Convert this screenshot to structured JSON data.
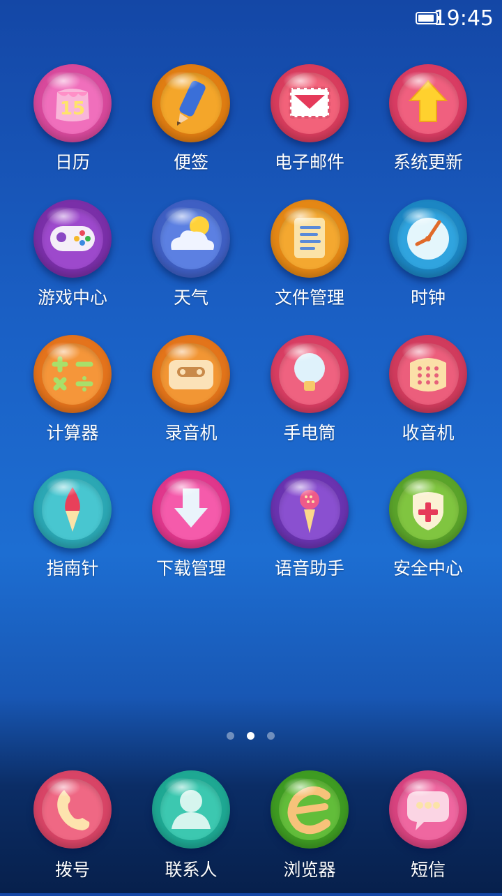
{
  "status": {
    "time": "19:45",
    "battery_percent": 90
  },
  "apps": [
    {
      "id": "calendar",
      "label": "日历",
      "color": "#d8499c",
      "inner": "#f06fbc",
      "icon": "calendar-icon",
      "text": "15"
    },
    {
      "id": "notes",
      "label": "便签",
      "color": "#e07d12",
      "inner": "#f4a62a",
      "icon": "pencil-icon"
    },
    {
      "id": "email",
      "label": "电子邮件",
      "color": "#d83c5d",
      "inner": "#f2627a",
      "icon": "envelope-icon"
    },
    {
      "id": "update",
      "label": "系统更新",
      "color": "#d93c63",
      "inner": "#f0607f",
      "icon": "up-arrow-icon"
    },
    {
      "id": "games",
      "label": "游戏中心",
      "color": "#7a2fa8",
      "inner": "#9d49cc",
      "icon": "gamepad-icon"
    },
    {
      "id": "weather",
      "label": "天气",
      "color": "#3f5fc3",
      "inner": "#5c80e2",
      "icon": "cloud-sun-icon"
    },
    {
      "id": "files",
      "label": "文件管理",
      "color": "#e48715",
      "inner": "#f4a830",
      "icon": "document-icon"
    },
    {
      "id": "clock",
      "label": "时钟",
      "color": "#1c86c3",
      "inner": "#30a4df",
      "icon": "clock-icon"
    },
    {
      "id": "calculator",
      "label": "计算器",
      "color": "#e4731c",
      "inner": "#f5963a",
      "icon": "calculator-icon"
    },
    {
      "id": "recorder",
      "label": "录音机",
      "color": "#e3741a",
      "inner": "#f29634",
      "icon": "cassette-icon"
    },
    {
      "id": "flashlight",
      "label": "手电筒",
      "color": "#d83d62",
      "inner": "#ef6280",
      "icon": "lightbulb-icon"
    },
    {
      "id": "radio",
      "label": "收音机",
      "color": "#d13b5d",
      "inner": "#ec5e7c",
      "icon": "radio-icon"
    },
    {
      "id": "compass",
      "label": "指南针",
      "color": "#2ba7b4",
      "inner": "#48c6d0",
      "icon": "compass-icon"
    },
    {
      "id": "downloads",
      "label": "下载管理",
      "color": "#e0378c",
      "inner": "#f55bab",
      "icon": "download-arrow-icon"
    },
    {
      "id": "assistant",
      "label": "语音助手",
      "color": "#6a33b0",
      "inner": "#8a50d0",
      "icon": "microphone-icon"
    },
    {
      "id": "security",
      "label": "安全中心",
      "color": "#5aa32a",
      "inner": "#80c540",
      "icon": "shield-icon"
    }
  ],
  "pager": {
    "pages": 3,
    "active": 1
  },
  "dock": [
    {
      "id": "dialer",
      "label": "拨号",
      "color": "#d84466",
      "inner": "#ef6884",
      "icon": "phone-icon"
    },
    {
      "id": "contacts",
      "label": "联系人",
      "color": "#1ea893",
      "inner": "#3cc8b0",
      "icon": "person-icon"
    },
    {
      "id": "browser",
      "label": "浏览器",
      "color": "#3e9b22",
      "inner": "#62bd3a",
      "icon": "browser-e-icon"
    },
    {
      "id": "messages",
      "label": "短信",
      "color": "#d8437f",
      "inner": "#ef67a0",
      "icon": "chat-bubble-icon"
    }
  ]
}
